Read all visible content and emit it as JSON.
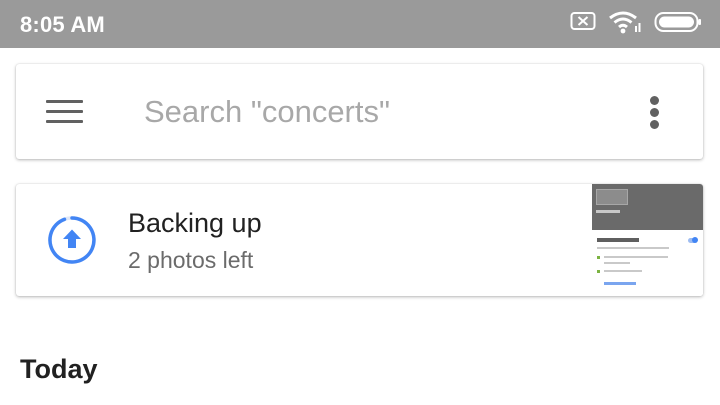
{
  "status_bar": {
    "time": "8:05 AM",
    "icons": [
      "no-sim-icon",
      "wifi-icon",
      "battery-icon"
    ]
  },
  "search": {
    "placeholder": "Search \"concerts\"",
    "menu_icon": "menu-icon",
    "more_icon": "more-vert-icon"
  },
  "backup": {
    "title": "Backing up",
    "subtitle": "2 photos left",
    "icon": "backup-upload-icon",
    "progress_color": "#4285f4"
  },
  "section": {
    "title": "Today"
  },
  "colors": {
    "status_bar": "#9a9a9a",
    "accent": "#4285f4"
  }
}
